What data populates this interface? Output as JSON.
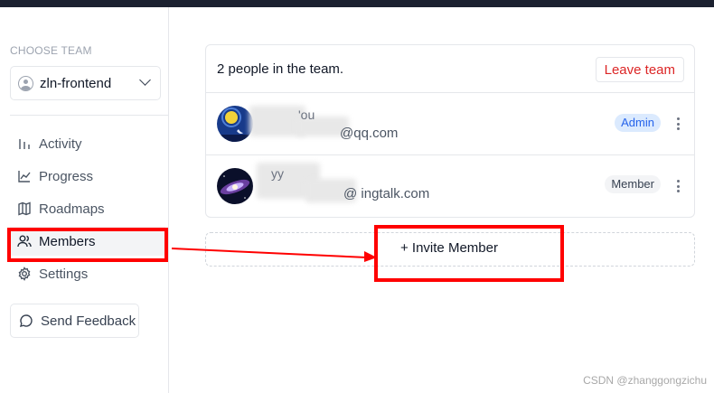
{
  "sidebar": {
    "choose_team_label": "CHOOSE TEAM",
    "team_name": "zln-frontend",
    "nav": [
      {
        "label": "Activity",
        "icon": "activity-icon"
      },
      {
        "label": "Progress",
        "icon": "chart-line-icon"
      },
      {
        "label": "Roadmaps",
        "icon": "map-icon"
      },
      {
        "label": "Members",
        "icon": "users-icon",
        "active": true
      },
      {
        "label": "Settings",
        "icon": "gear-icon"
      }
    ],
    "feedback_label": "Send Feedback"
  },
  "team": {
    "people_count_text": "2 people in the team.",
    "leave_label": "Leave team",
    "members": [
      {
        "name": "'ou",
        "email": "@qq.com",
        "role": "Admin"
      },
      {
        "name": "yy",
        "email": "@ ingtalk.com",
        "role": "Member"
      }
    ],
    "invite_label": "+ Invite Member"
  },
  "colors": {
    "accent": "#2563eb",
    "danger": "#dc2626",
    "annotation": "#ff0000",
    "topbar": "#1b2130"
  },
  "watermark": "CSDN @zhanggongzichu"
}
